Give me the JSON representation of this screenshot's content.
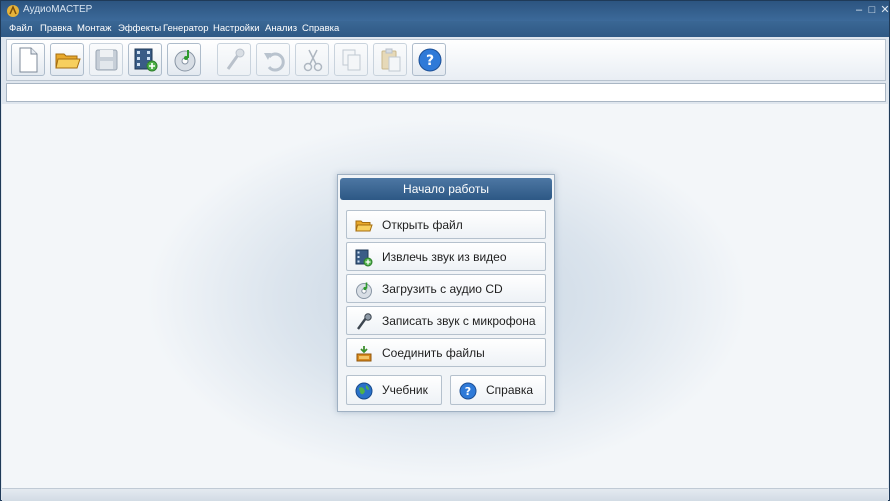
{
  "window": {
    "title": "АудиоМАСТЕР"
  },
  "menu": [
    "Файл",
    "Правка",
    "Монтаж",
    "Эффекты",
    "Генератор",
    "Настройки",
    "Анализ",
    "Справка"
  ],
  "toolbar": {
    "buttons": [
      {
        "icon": "new-file-icon",
        "enabled": true
      },
      {
        "icon": "open-folder-icon",
        "enabled": true
      },
      {
        "icon": "save-icon",
        "enabled": false
      },
      {
        "icon": "video-extract-icon",
        "enabled": true
      },
      {
        "icon": "audio-cd-icon",
        "enabled": true
      },
      {
        "icon": "microphone-icon",
        "enabled": false
      },
      {
        "icon": "undo-icon",
        "enabled": false
      },
      {
        "icon": "cut-icon",
        "enabled": false
      },
      {
        "icon": "copy-icon",
        "enabled": false
      },
      {
        "icon": "paste-icon",
        "enabled": false
      },
      {
        "icon": "help-icon",
        "enabled": true
      }
    ]
  },
  "start_panel": {
    "title": "Начало работы",
    "open_file": "Открыть файл",
    "extract_audio": "Извлечь звук из видео",
    "load_cd": "Загрузить с аудио CD",
    "record_mic": "Записать звук с микрофона",
    "join_files": "Соединить файлы",
    "tutorial": "Учебник",
    "help": "Справка"
  },
  "colors": {
    "accent": "#2d5885",
    "help_blue": "#2f7ad8"
  }
}
